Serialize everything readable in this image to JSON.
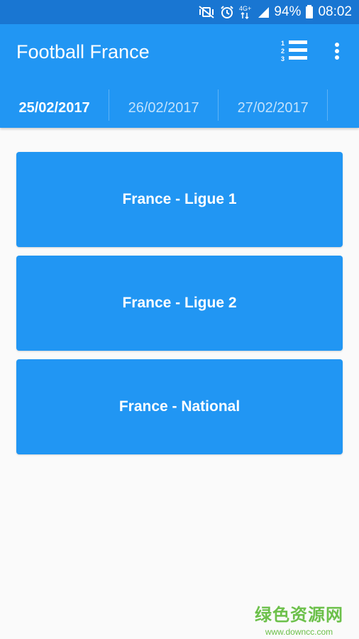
{
  "status_bar": {
    "battery_percent": "94%",
    "time": "08:02",
    "network_label": "4G+",
    "icons": [
      "mute-vibrate-icon",
      "alarm-icon",
      "network-4g-icon",
      "signal-icon",
      "battery-icon"
    ]
  },
  "app_bar": {
    "title": "Football France",
    "actions": [
      "ranking-list-icon",
      "more-vert-icon"
    ]
  },
  "tabs": [
    {
      "label": "25/02/2017",
      "active": true
    },
    {
      "label": "26/02/2017",
      "active": false
    },
    {
      "label": "27/02/2017",
      "active": false
    }
  ],
  "leagues": [
    {
      "label": "France - Ligue 1"
    },
    {
      "label": "France - Ligue 2"
    },
    {
      "label": "France - National"
    }
  ],
  "watermark": {
    "main": "绿色资源网",
    "sub": "www.downcc.com"
  },
  "colors": {
    "status_bar": "#1976d2",
    "primary": "#2196f3",
    "background": "#fafafa",
    "watermark": "#6cc04a"
  }
}
